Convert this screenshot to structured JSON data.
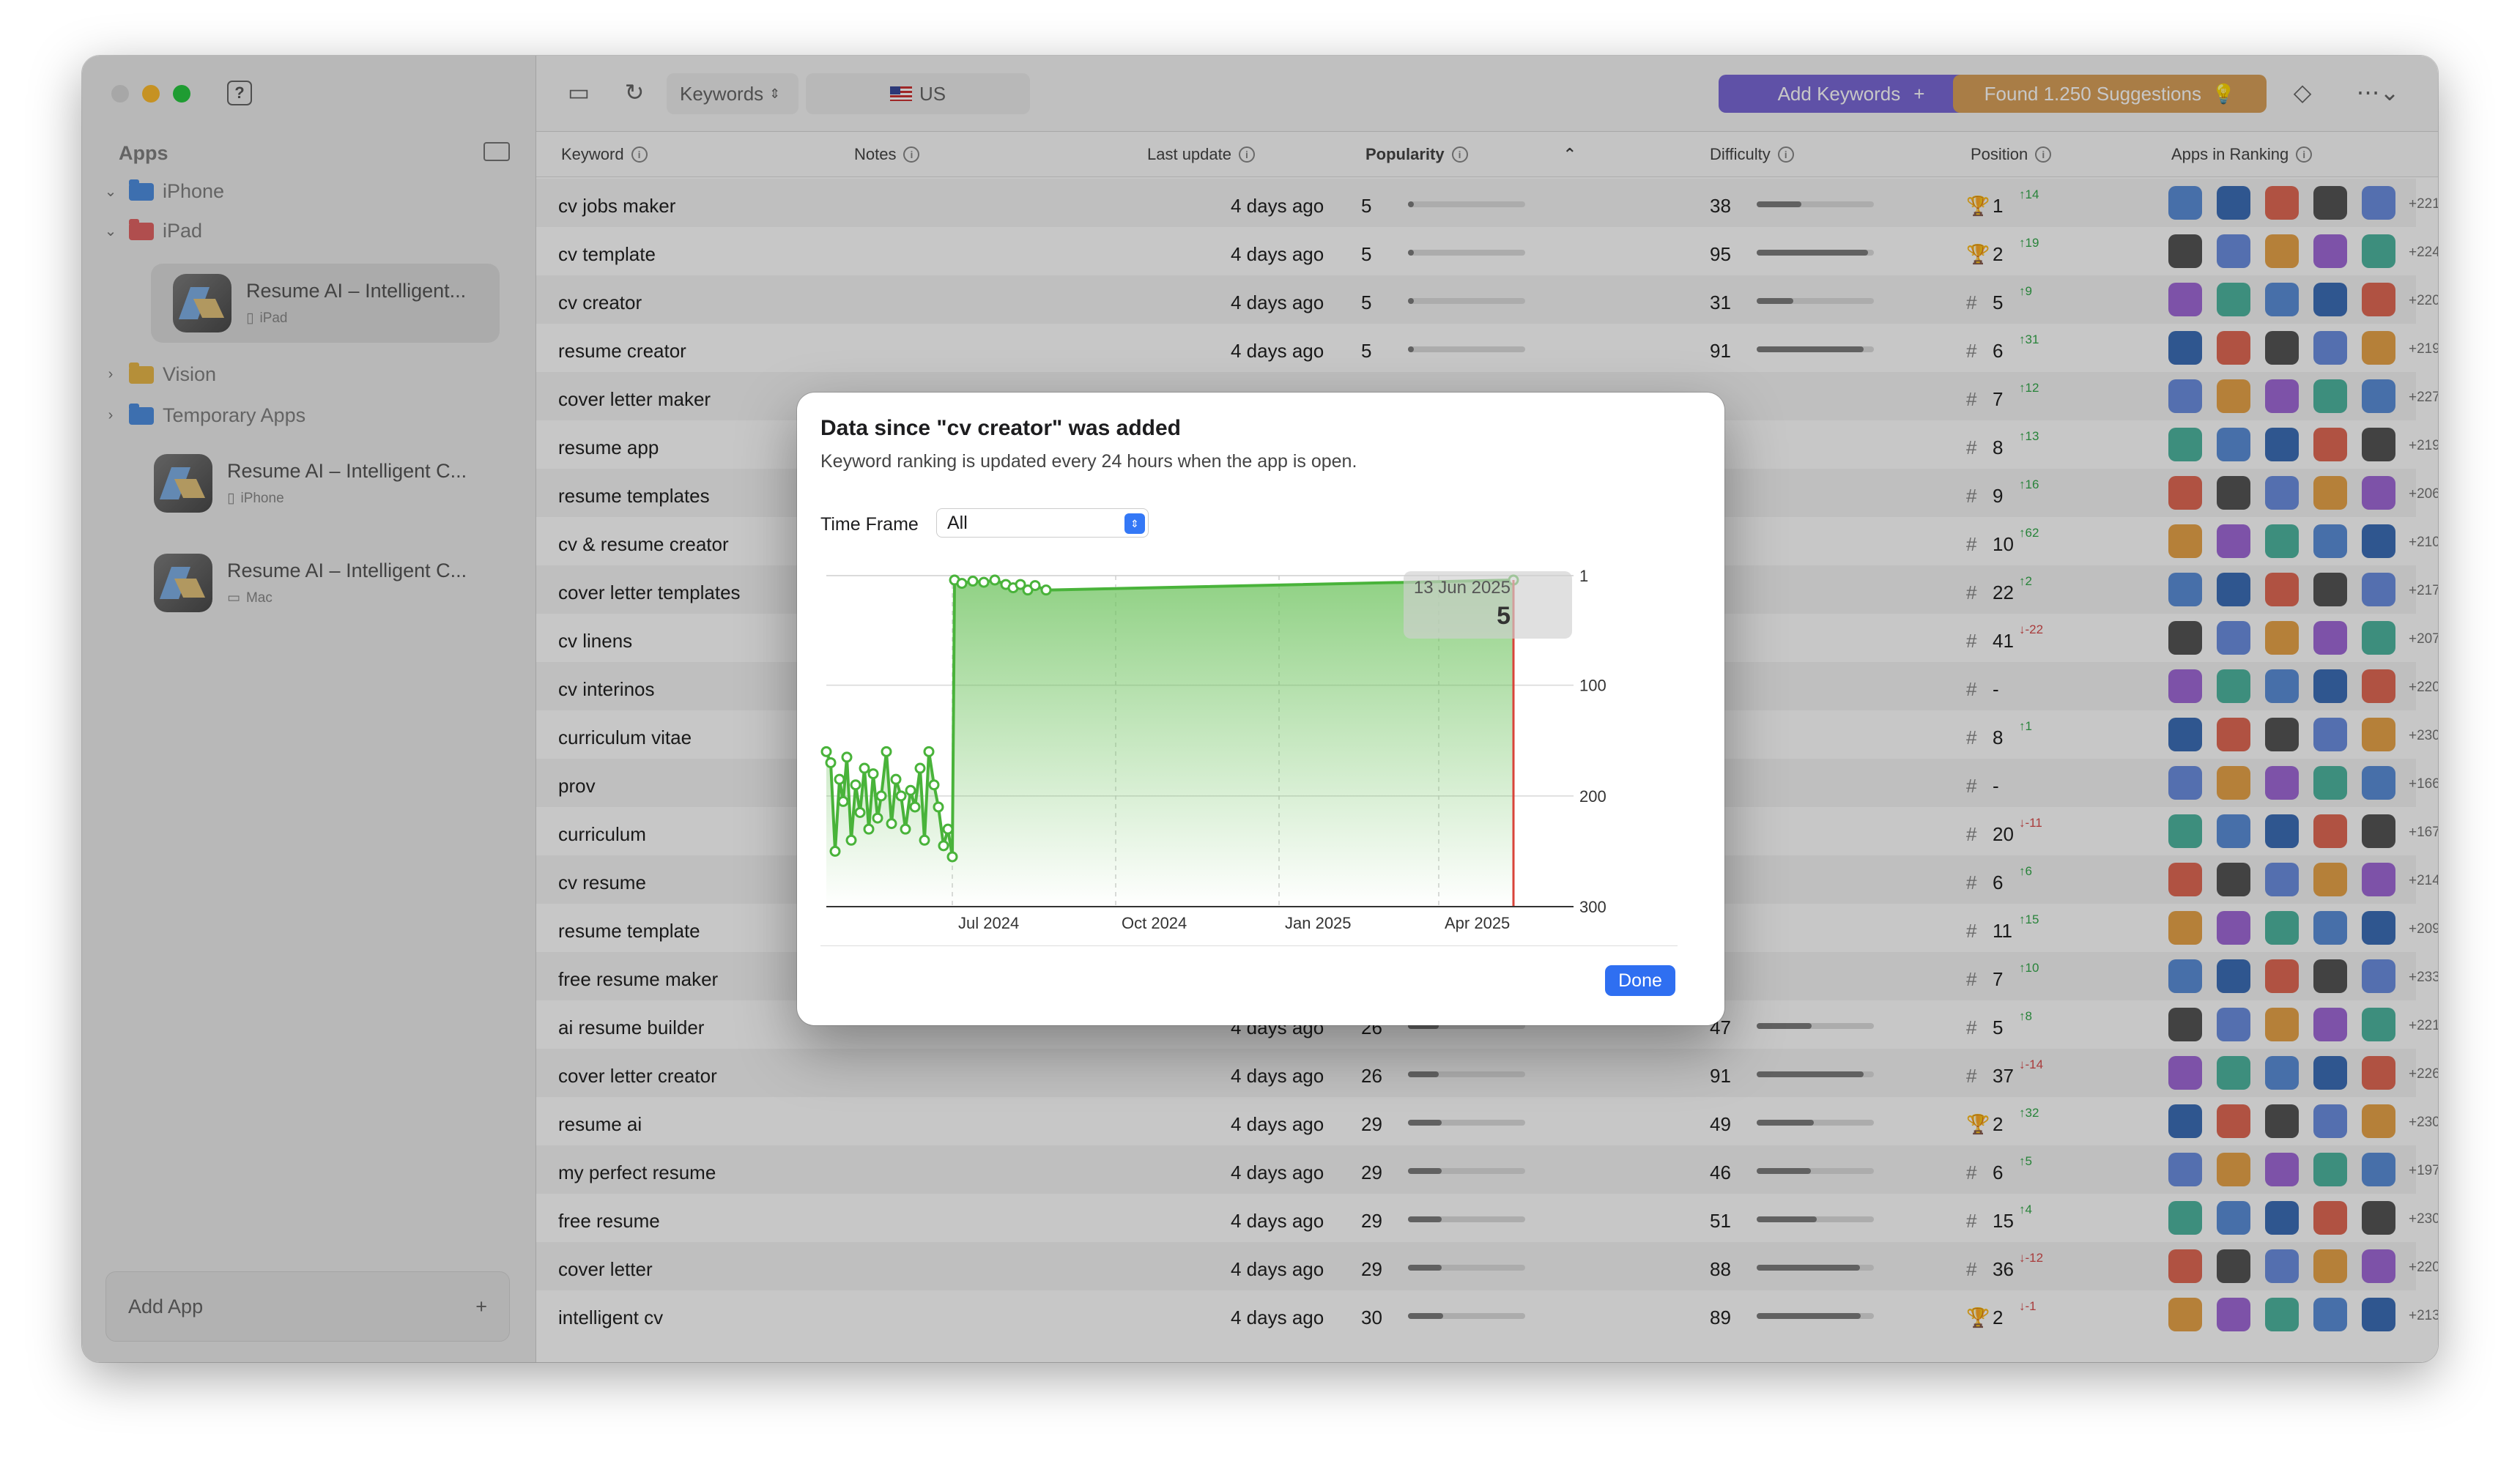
{
  "sidebar": {
    "title": "Apps",
    "groups": [
      {
        "label": "iPhone",
        "color": "#4f8fe0"
      },
      {
        "label": "iPad",
        "color": "#e26464"
      },
      {
        "label": "Vision",
        "color": "#e8b84a"
      },
      {
        "label": "Temporary Apps",
        "color": "#4f8fe0"
      }
    ],
    "apps": [
      {
        "name": "Resume AI – Intelligent...",
        "platform": "iPad"
      },
      {
        "name": "Resume AI – Intelligent C...",
        "platform": "iPhone"
      },
      {
        "name": "Resume AI – Intelligent C...",
        "platform": "Mac"
      }
    ],
    "add_app": "Add App",
    "add_icon": "+"
  },
  "toolbar": {
    "keyword_select": "Keywords",
    "region": "US",
    "add_keywords": "Add Keywords",
    "add_icon": "+",
    "suggestions": "Found 1.250 Suggestions"
  },
  "columns": {
    "keyword": "Keyword",
    "notes": "Notes",
    "last_update": "Last update",
    "popularity": "Popularity",
    "difficulty": "Difficulty",
    "position": "Position",
    "apps_in_ranking": "Apps in Ranking"
  },
  "rows": [
    {
      "kw": "cv jobs maker",
      "upd": "4 days ago",
      "pop": 5,
      "diff": 38,
      "pos_type": "trophy",
      "pos": "1",
      "chg": "↑14",
      "dir": "up",
      "more": "+221"
    },
    {
      "kw": "cv template",
      "upd": "4 days ago",
      "pop": 5,
      "diff": 95,
      "pos_type": "trophy",
      "pos": "2",
      "chg": "↑19",
      "dir": "up",
      "more": "+224"
    },
    {
      "kw": "cv creator",
      "upd": "4 days ago",
      "pop": 5,
      "diff": 31,
      "pos_type": "#",
      "pos": "5",
      "chg": "↑9",
      "dir": "up",
      "more": "+220"
    },
    {
      "kw": "resume creator",
      "upd": "4 days ago",
      "pop": 5,
      "diff": 91,
      "pos_type": "#",
      "pos": "6",
      "chg": "↑31",
      "dir": "up",
      "more": "+219"
    },
    {
      "kw": "cover letter maker",
      "upd": "",
      "pop": null,
      "diff": null,
      "pos_type": "#",
      "pos": "7",
      "chg": "↑12",
      "dir": "up",
      "more": "+227"
    },
    {
      "kw": "resume app",
      "upd": "",
      "pop": null,
      "diff": null,
      "pos_type": "#",
      "pos": "8",
      "chg": "↑13",
      "dir": "up",
      "more": "+219"
    },
    {
      "kw": "resume templates",
      "upd": "",
      "pop": null,
      "diff": null,
      "pos_type": "#",
      "pos": "9",
      "chg": "↑16",
      "dir": "up",
      "more": "+206"
    },
    {
      "kw": "cv & resume creator",
      "upd": "",
      "pop": null,
      "diff": null,
      "pos_type": "#",
      "pos": "10",
      "chg": "↑62",
      "dir": "up",
      "more": "+210"
    },
    {
      "kw": "cover letter templates",
      "upd": "",
      "pop": null,
      "diff": null,
      "pos_type": "#",
      "pos": "22",
      "chg": "↑2",
      "dir": "up",
      "more": "+217"
    },
    {
      "kw": "cv linens",
      "upd": "",
      "pop": null,
      "diff": null,
      "pos_type": "#",
      "pos": "41",
      "chg": "↓-22",
      "dir": "down",
      "more": "+207"
    },
    {
      "kw": "cv interinos",
      "upd": "",
      "pop": null,
      "diff": null,
      "pos_type": "#",
      "pos": "-",
      "chg": "",
      "dir": "up",
      "more": "+220"
    },
    {
      "kw": "curriculum vitae",
      "upd": "",
      "pop": null,
      "diff": null,
      "pos_type": "#",
      "pos": "8",
      "chg": "↑1",
      "dir": "up",
      "more": "+230"
    },
    {
      "kw": "prov",
      "upd": "",
      "pop": null,
      "diff": null,
      "pos_type": "#",
      "pos": "-",
      "chg": "",
      "dir": "up",
      "more": "+166"
    },
    {
      "kw": "curriculum",
      "upd": "",
      "pop": null,
      "diff": null,
      "pos_type": "#",
      "pos": "20",
      "chg": "↓-11",
      "dir": "down",
      "more": "+167"
    },
    {
      "kw": "cv resume",
      "upd": "",
      "pop": null,
      "diff": null,
      "pos_type": "#",
      "pos": "6",
      "chg": "↑6",
      "dir": "up",
      "more": "+214"
    },
    {
      "kw": "resume template",
      "upd": "",
      "pop": null,
      "diff": null,
      "pos_type": "#",
      "pos": "11",
      "chg": "↑15",
      "dir": "up",
      "more": "+209"
    },
    {
      "kw": "free resume maker",
      "upd": "",
      "pop": null,
      "diff": null,
      "pos_type": "#",
      "pos": "7",
      "chg": "↑10",
      "dir": "up",
      "more": "+233"
    },
    {
      "kw": "ai resume builder",
      "upd": "4 days ago",
      "pop": 26,
      "diff": 47,
      "pos_type": "#",
      "pos": "5",
      "chg": "↑8",
      "dir": "up",
      "more": "+221"
    },
    {
      "kw": "cover letter creator",
      "upd": "4 days ago",
      "pop": 26,
      "diff": 91,
      "pos_type": "#",
      "pos": "37",
      "chg": "↓-14",
      "dir": "down",
      "more": "+226"
    },
    {
      "kw": "resume ai",
      "upd": "4 days ago",
      "pop": 29,
      "diff": 49,
      "pos_type": "trophy",
      "pos": "2",
      "chg": "↑32",
      "dir": "up",
      "more": "+230"
    },
    {
      "kw": "my perfect resume",
      "upd": "4 days ago",
      "pop": 29,
      "diff": 46,
      "pos_type": "#",
      "pos": "6",
      "chg": "↑5",
      "dir": "up",
      "more": "+197"
    },
    {
      "kw": "free resume",
      "upd": "4 days ago",
      "pop": 29,
      "diff": 51,
      "pos_type": "#",
      "pos": "15",
      "chg": "↑4",
      "dir": "up",
      "more": "+230"
    },
    {
      "kw": "cover letter",
      "upd": "4 days ago",
      "pop": 29,
      "diff": 88,
      "pos_type": "#",
      "pos": "36",
      "chg": "↓-12",
      "dir": "down",
      "more": "+220"
    },
    {
      "kw": "intelligent cv",
      "upd": "4 days ago",
      "pop": 30,
      "diff": 89,
      "pos_type": "trophy",
      "pos": "2",
      "chg": "↓-1",
      "dir": "down",
      "more": "+213"
    }
  ],
  "app_icon_colors": [
    "#5b8fd9",
    "#3d6fb8",
    "#e26a55",
    "#555555",
    "#6c8fe0",
    "#e8a44a",
    "#a06ad8",
    "#4fb6a0"
  ],
  "modal": {
    "title": "Data since \"cv creator\" was added",
    "subtitle": "Keyword ranking is updated every 24 hours when the app is open.",
    "timeframe_label": "Time Frame",
    "timeframe_value": "All",
    "done": "Done"
  },
  "chart_data": {
    "type": "line",
    "title": "",
    "x_ticks": [
      "Jul 2024",
      "Oct 2024",
      "Jan 2025",
      "Apr 2025"
    ],
    "y_ticks": [
      "1",
      "100",
      "200",
      "300"
    ],
    "y_inverted": true,
    "ylim": [
      1,
      300
    ],
    "tooltip": {
      "date": "13 Jun 2025",
      "value": "5"
    },
    "series": [
      {
        "values": [
          [
            0.0,
            160
          ],
          [
            0.6,
            170
          ],
          [
            1.2,
            250
          ],
          [
            1.8,
            185
          ],
          [
            2.3,
            205
          ],
          [
            2.8,
            165
          ],
          [
            3.4,
            240
          ],
          [
            4.0,
            190
          ],
          [
            4.6,
            215
          ],
          [
            5.2,
            175
          ],
          [
            5.8,
            230
          ],
          [
            6.4,
            180
          ],
          [
            7.0,
            220
          ],
          [
            7.5,
            200
          ],
          [
            8.2,
            160
          ],
          [
            8.9,
            225
          ],
          [
            9.5,
            185
          ],
          [
            10.2,
            200
          ],
          [
            10.8,
            230
          ],
          [
            11.5,
            195
          ],
          [
            12.1,
            210
          ],
          [
            12.8,
            175
          ],
          [
            13.4,
            240
          ],
          [
            14.0,
            160
          ],
          [
            14.7,
            190
          ],
          [
            15.3,
            210
          ],
          [
            16.0,
            245
          ],
          [
            16.6,
            230
          ],
          [
            17.2,
            255
          ],
          [
            17.5,
            5
          ],
          [
            18.5,
            8
          ],
          [
            20,
            6
          ],
          [
            21.5,
            7
          ],
          [
            23,
            5
          ],
          [
            24.5,
            9
          ],
          [
            25.5,
            12
          ],
          [
            26.5,
            9
          ],
          [
            27.5,
            14
          ],
          [
            28.5,
            10
          ],
          [
            30,
            14
          ],
          [
            93.8,
            5
          ]
        ],
        "color": "#49b33a"
      }
    ]
  }
}
